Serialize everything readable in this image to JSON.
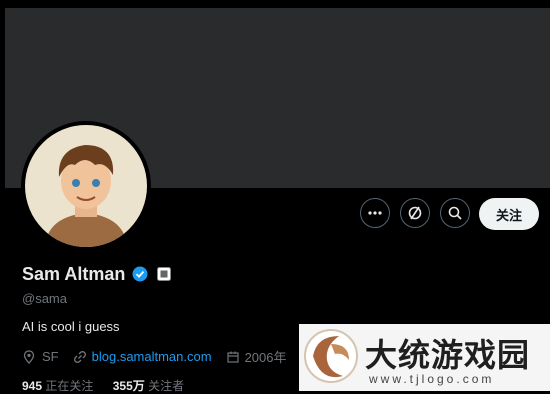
{
  "profile": {
    "name": "Sam Altman",
    "handle": "@sama",
    "bio": "AI is cool i guess",
    "location": "SF",
    "website": "blog.samaltman.com",
    "joined": "2006年",
    "following_count": "945",
    "following_label": "正在关注",
    "followers_count": "355万",
    "followers_label": "关注者"
  },
  "actions": {
    "follow_label": "关注",
    "more_icon": "more-icon",
    "subscribe_icon": "notification-off-icon",
    "search_icon": "search-icon"
  },
  "watermark": {
    "title": "大统游戏园",
    "url": "www.tjlogo.com"
  },
  "colors": {
    "accent": "#1d9bf0",
    "banner": "#2a2b2d",
    "background": "#000000"
  }
}
